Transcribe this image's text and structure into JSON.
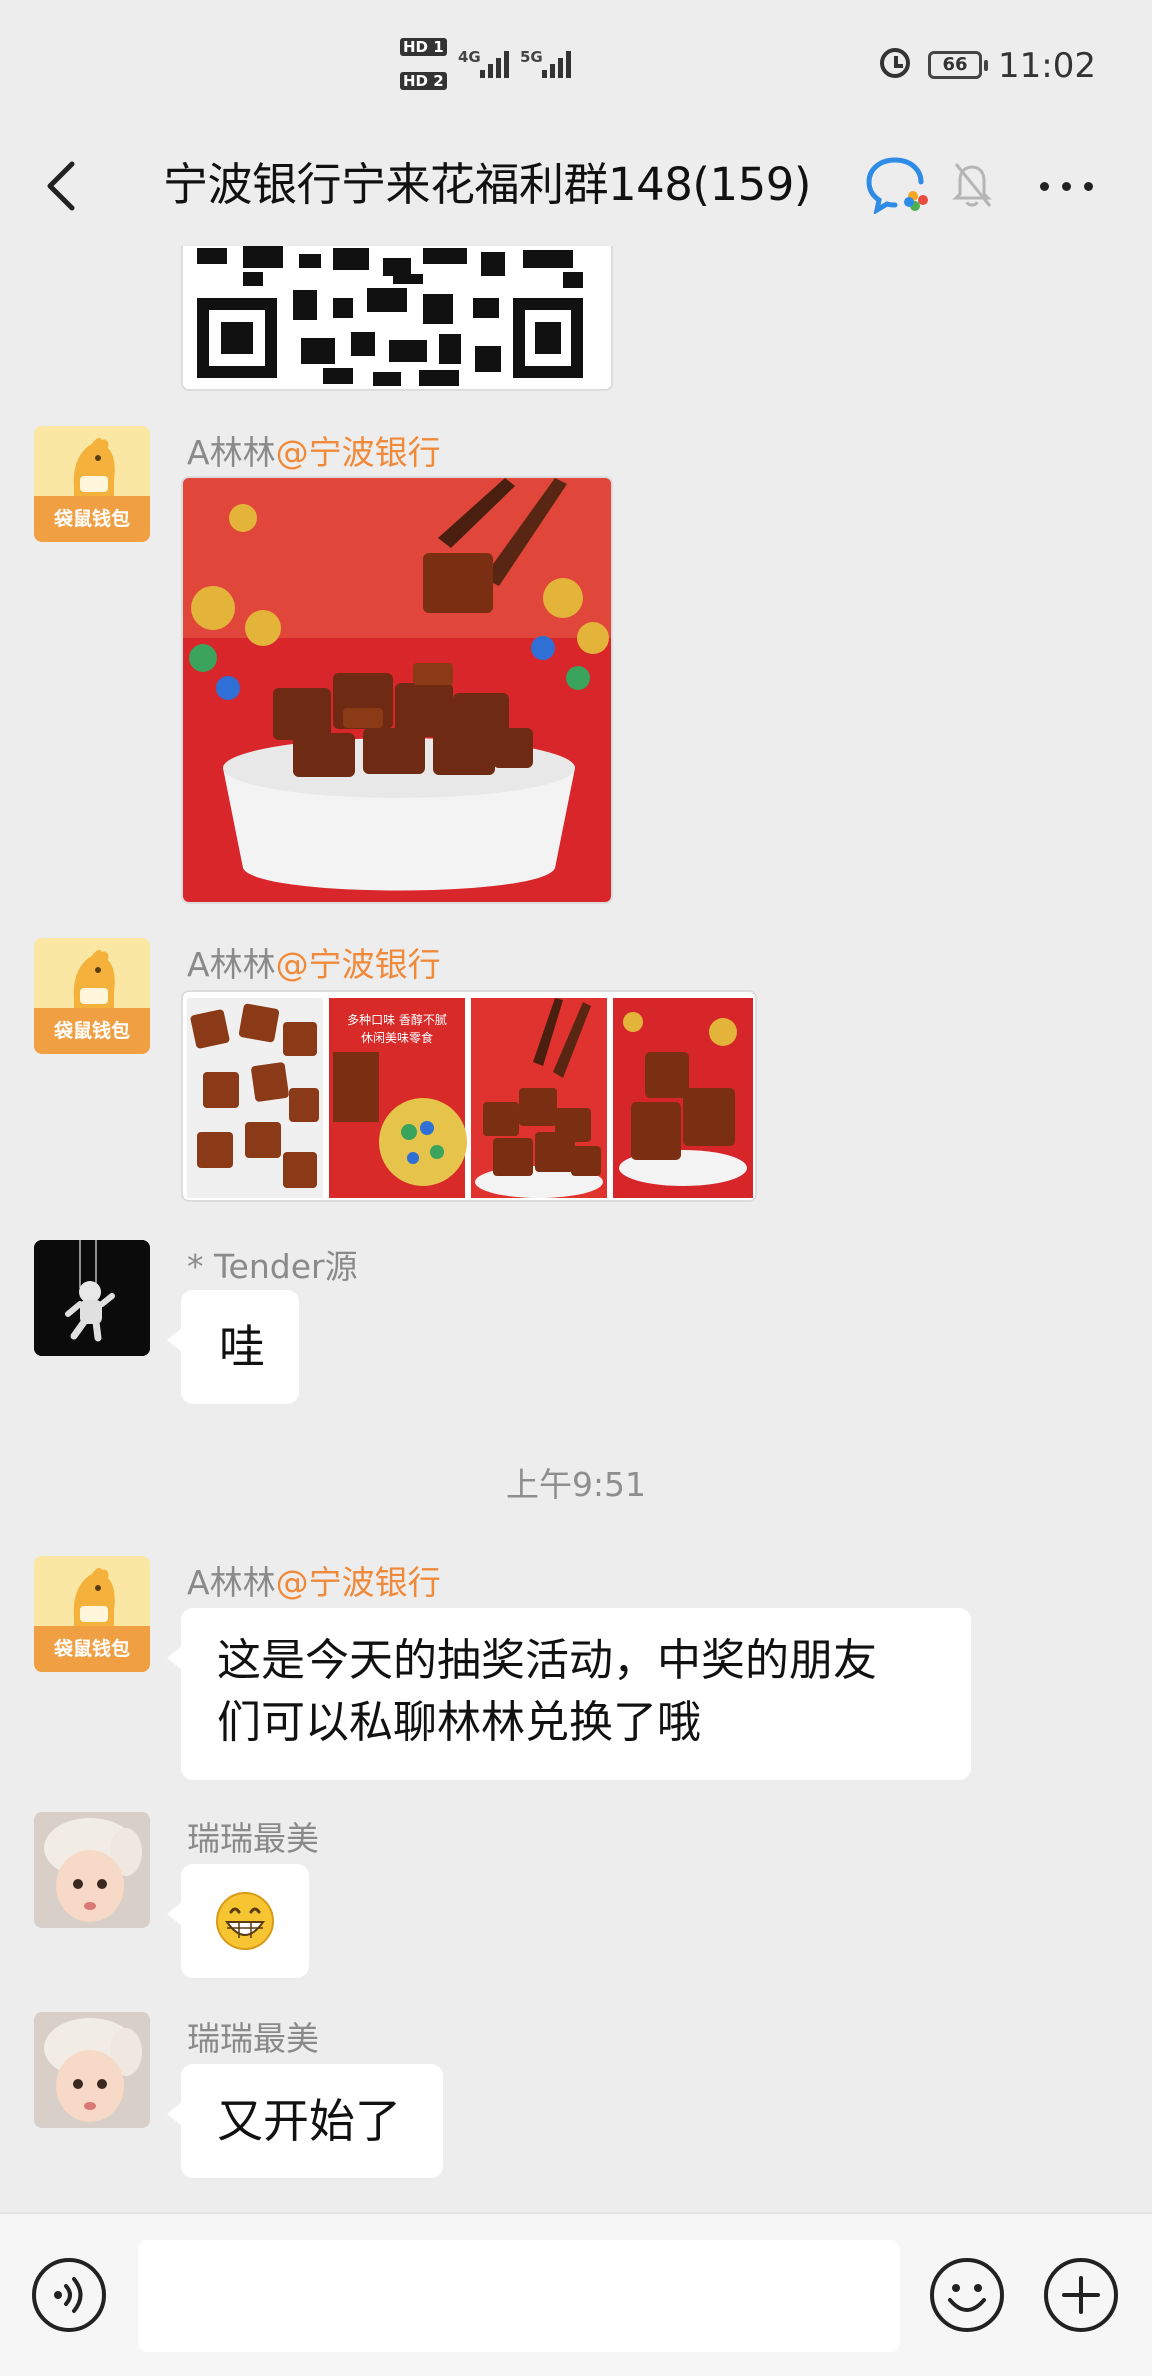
{
  "status_bar": {
    "hd1": "HD 1",
    "hd2": "HD 2",
    "net1": "4G",
    "net2": "5G",
    "battery": "66",
    "time": "11:02"
  },
  "nav": {
    "title": "宁波银行宁来花福利群148(159)"
  },
  "messages": [
    {
      "type": "image",
      "content": "qr-code"
    },
    {
      "type": "image",
      "sender_name": "A林林",
      "sender_org": "@宁波银行",
      "avatar_text": "袋鼠钱包",
      "content": "beef-jerky-photo"
    },
    {
      "type": "image",
      "sender_name": "A林林",
      "sender_org": "@宁波银行",
      "avatar_text": "袋鼠钱包",
      "content": "beef-jerky-collage",
      "collage_caption": [
        "多种口味 香醇不腻",
        "休闲美味零食"
      ]
    },
    {
      "type": "text",
      "sender_name": "* Tender源",
      "text": "哇"
    },
    {
      "type": "time",
      "text": "上午9:51"
    },
    {
      "type": "text",
      "sender_name": "A林林",
      "sender_org": "@宁波银行",
      "avatar_text": "袋鼠钱包",
      "text_lines": [
        "这是今天的抽奖活动，中奖的朋友",
        "们可以私聊林林兑换了哦"
      ]
    },
    {
      "type": "emoji",
      "sender_name": "瑞瑞最美",
      "emoji": "grinning-face"
    },
    {
      "type": "text",
      "sender_name": "瑞瑞最美",
      "text": "又开始了"
    }
  ],
  "input": {
    "value": "",
    "placeholder": ""
  },
  "colors": {
    "background": "#ededed",
    "bubble": "#ffffff",
    "org_tag": "#f08a3a",
    "pouch_yellow": "#fbe7a4",
    "pouch_orange": "#f0a043"
  }
}
